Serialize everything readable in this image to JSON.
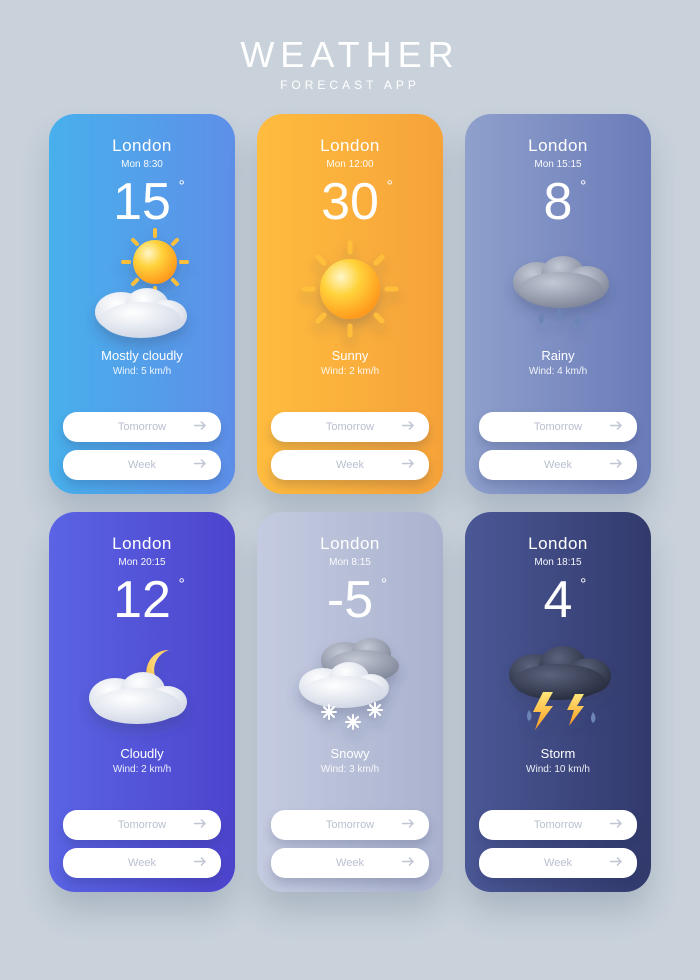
{
  "header": {
    "title": "WEATHER",
    "subtitle": "FORECAST APP"
  },
  "shared": {
    "city": "London",
    "buttons": {
      "tomorrow": "Tomorrow",
      "week": "Week"
    }
  },
  "cards": [
    {
      "time": "Mon 8:30",
      "temp": "15",
      "condition": "Mostly cloudly",
      "wind": "Wind: 5 km/h"
    },
    {
      "time": "Mon 12:00",
      "temp": "30",
      "condition": "Sunny",
      "wind": "Wind: 2 km/h"
    },
    {
      "time": "Mon 15:15",
      "temp": "8",
      "condition": "Rainy",
      "wind": "Wind: 4 km/h"
    },
    {
      "time": "Mon 20:15",
      "temp": "12",
      "condition": "Cloudly",
      "wind": "Wind: 2 km/h"
    },
    {
      "time": "Mon 8:15",
      "temp": "-5",
      "condition": "Snowy",
      "wind": "Wind: 3 km/h"
    },
    {
      "time": "Mon 18:15",
      "temp": "4",
      "condition": "Storm",
      "wind": "Wind: 10 km/h"
    }
  ]
}
